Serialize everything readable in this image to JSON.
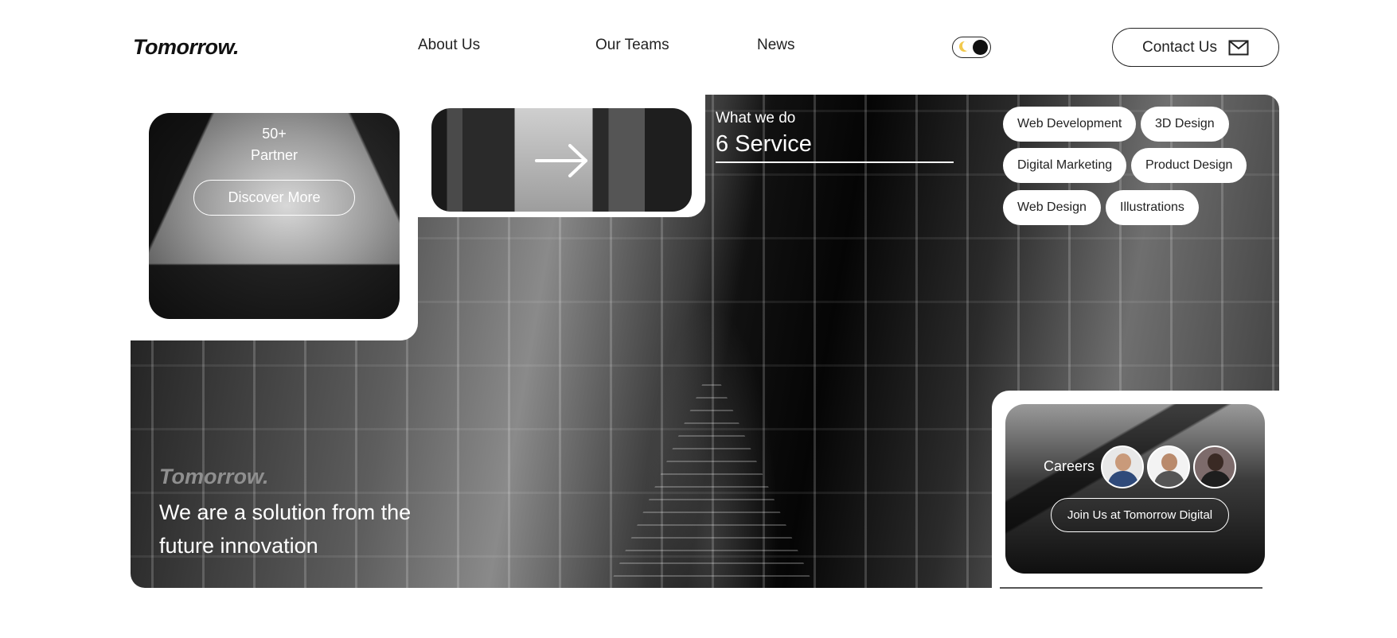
{
  "header": {
    "logo": "Tomorrow.",
    "nav": [
      "About Us",
      "Our Teams",
      "News"
    ],
    "contact_label": "Contact Us"
  },
  "theme_toggle": {
    "state": "dark",
    "icon": "moon-icon"
  },
  "partner": {
    "count": "50+",
    "label": "Partner",
    "button": "Discover More"
  },
  "services": {
    "title": "What we do",
    "count": "6 Service",
    "tags": [
      "Web Development",
      "3D Design",
      "Digital Marketing",
      "Product Design",
      "Web Design",
      "Illustrations"
    ]
  },
  "tagline": {
    "brand": "Tomorrow.",
    "text": "We are a solution from the future innovation"
  },
  "careers": {
    "label": "Careers",
    "button": "Join Us at Tomorrow Digital"
  },
  "colors": {
    "background": "#ffffff",
    "text": "#111111",
    "accent": "#ffffff",
    "moon": "#f2c94c"
  }
}
